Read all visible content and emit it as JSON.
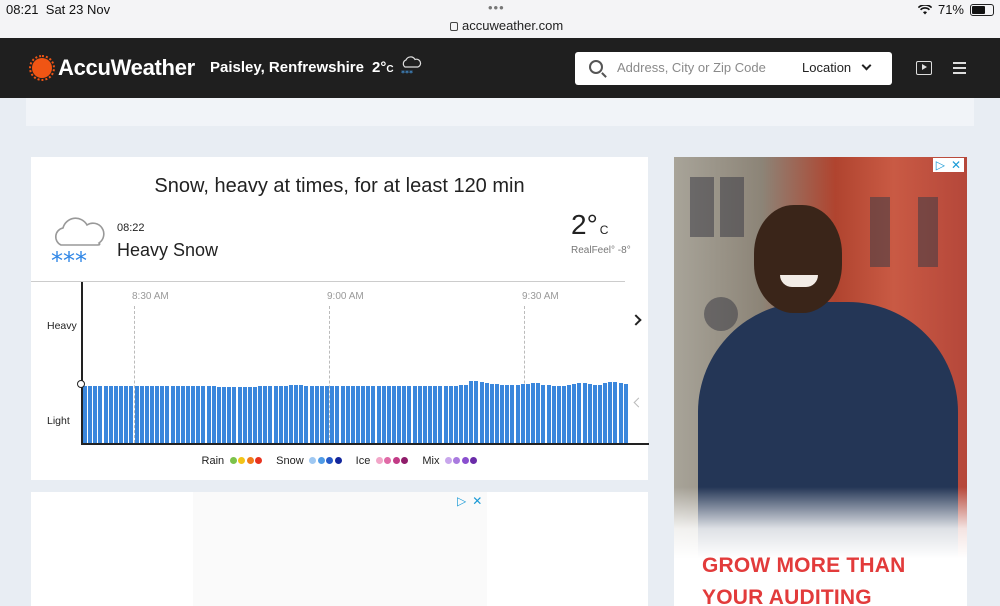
{
  "status_bar": {
    "time": "08:21",
    "date": "Sat 23 Nov",
    "url": "accuweather.com",
    "battery": "71%"
  },
  "header": {
    "logo": "AccuWeather",
    "location": "Paisley, Renfrewshire",
    "temp": "2°",
    "temp_unit": "C",
    "search_placeholder": "Address, City or Zip Code",
    "location_button": "Location"
  },
  "minutecast": {
    "title": "Snow, heavy at times, for at least 120 min",
    "time": "08:22",
    "condition": "Heavy Snow",
    "temp": "2°",
    "temp_unit": "C",
    "realfeel": "RealFeel° -8°",
    "y_labels": {
      "heavy": "Heavy",
      "light": "Light"
    },
    "time_ticks": [
      "8:30 AM",
      "9:00 AM",
      "9:30 AM"
    ],
    "legend": [
      {
        "label": "Rain",
        "colors": [
          "#7cc24a",
          "#f2c418",
          "#f07a1a",
          "#e8331f"
        ]
      },
      {
        "label": "Snow",
        "colors": [
          "#9fc8f2",
          "#4f9be6",
          "#2559c7",
          "#12269c"
        ]
      },
      {
        "label": "Ice",
        "colors": [
          "#f2a6c8",
          "#e06aa6",
          "#c23b86",
          "#8f1c6a"
        ]
      },
      {
        "label": "Mix",
        "colors": [
          "#c8a6ec",
          "#a97adf",
          "#8a4fcf",
          "#6a2ba8"
        ]
      }
    ]
  },
  "chart_data": {
    "type": "bar",
    "xlabel": "",
    "ylabel": "",
    "y_categories": [
      "Light",
      "Heavy"
    ],
    "x_ticks": [
      "8:30 AM",
      "9:00 AM",
      "9:30 AM"
    ],
    "series": [
      {
        "values": [
          0.57,
          0.57,
          0.57,
          0.57,
          0.57,
          0.57,
          0.57,
          0.57,
          0.57,
          0.57,
          0.57,
          0.57,
          0.57,
          0.57,
          0.57,
          0.57,
          0.57,
          0.57,
          0.57,
          0.57,
          0.57,
          0.57,
          0.57,
          0.57,
          0.57,
          0.57,
          0.56,
          0.56,
          0.56,
          0.56,
          0.56,
          0.56,
          0.56,
          0.56,
          0.57,
          0.57,
          0.57,
          0.57,
          0.57,
          0.57,
          0.58,
          0.58,
          0.58,
          0.57,
          0.57,
          0.57,
          0.57,
          0.57,
          0.57,
          0.57,
          0.57,
          0.57,
          0.57,
          0.57,
          0.57,
          0.57,
          0.57,
          0.57,
          0.57,
          0.57,
          0.57,
          0.57,
          0.57,
          0.57,
          0.57,
          0.57,
          0.57,
          0.57,
          0.57,
          0.57,
          0.57,
          0.57,
          0.57,
          0.58,
          0.58,
          0.62,
          0.62,
          0.61,
          0.6,
          0.59,
          0.59,
          0.58,
          0.58,
          0.58,
          0.58,
          0.59,
          0.59,
          0.6,
          0.6,
          0.58,
          0.58,
          0.57,
          0.57,
          0.57,
          0.58,
          0.59,
          0.6,
          0.6,
          0.59,
          0.58,
          0.58,
          0.6,
          0.61,
          0.61,
          0.6,
          0.59
        ]
      }
    ]
  },
  "ads": {
    "side_ad_text": [
      "GROW MORE THAN",
      "YOUR AUDITING"
    ],
    "adchoices_icon": "adchoices-icon",
    "close_icon": "close-icon"
  }
}
